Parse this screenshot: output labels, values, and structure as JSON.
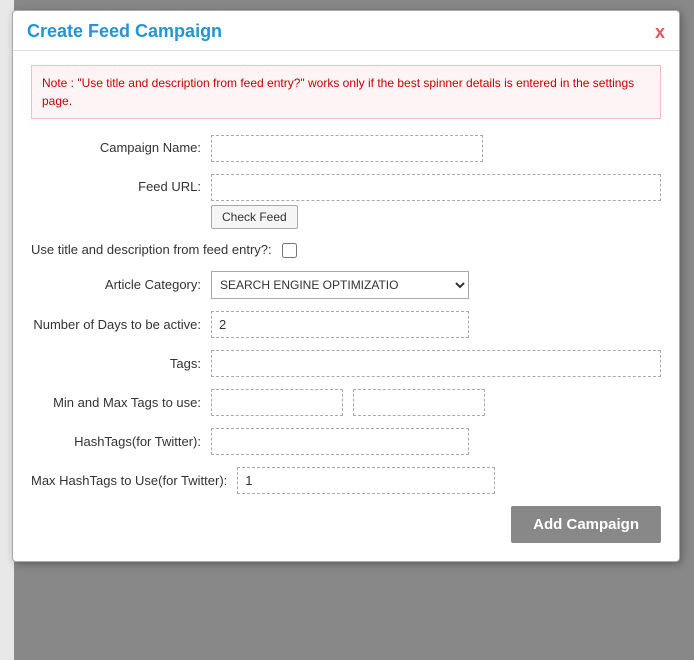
{
  "dialog": {
    "title": "Create Feed Campaign",
    "close_label": "x"
  },
  "note": {
    "text": "Note : \"Use title and description from feed entry?\" works only if the best spinner details is entered in the settings page."
  },
  "form": {
    "campaign_name_label": "Campaign Name:",
    "campaign_name_value": "",
    "campaign_name_placeholder": "",
    "feed_url_label": "Feed URL:",
    "feed_url_value": "",
    "check_feed_label": "Check Feed",
    "use_title_label": "Use title and description from feed entry?:",
    "use_title_checked": false,
    "article_category_label": "Article Category:",
    "article_category_value": "SEARCH ENGINE OPTIMIZATIO",
    "article_category_options": [
      "SEARCH ENGINE OPTIMIZATIO"
    ],
    "days_label": "Number of Days to be active:",
    "days_value": "2",
    "tags_label": "Tags:",
    "tags_value": "",
    "minmax_label": "Min and Max Tags to use:",
    "minmax_value1": "",
    "minmax_value2": "",
    "hashtags_label": "HashTags(for Twitter):",
    "hashtags_value": "",
    "max_hashtags_label": "Max HashTags to Use(for Twitter):",
    "max_hashtags_value": "1",
    "add_campaign_label": "Add Campaign"
  }
}
